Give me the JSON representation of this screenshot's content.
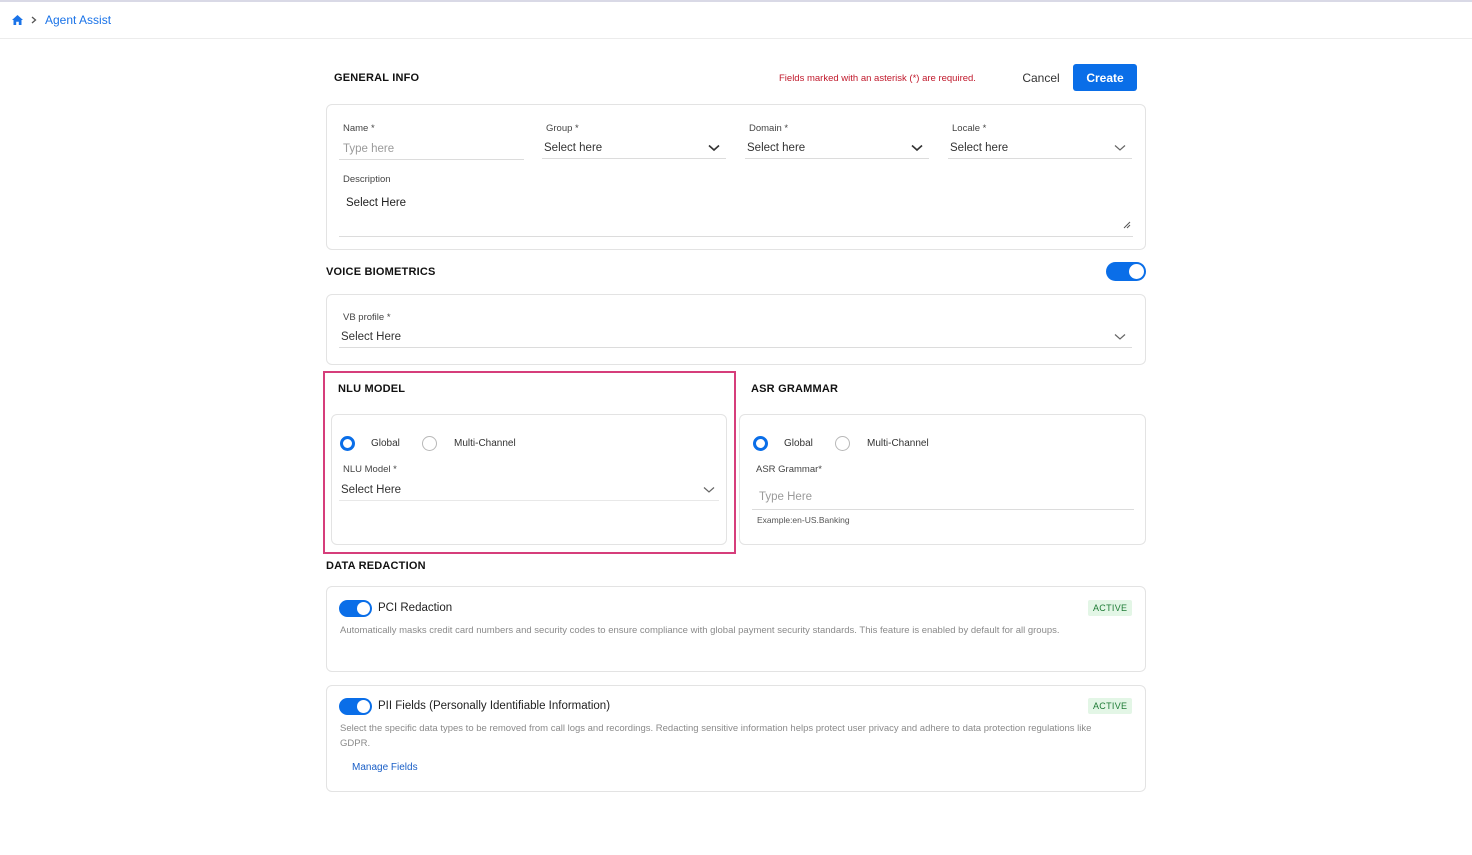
{
  "breadcrumb": {
    "current": "Agent Assist"
  },
  "general_info": {
    "title": "GENERAL INFO",
    "required_note": "Fields marked with an asterisk (*) are required.",
    "cancel_label": "Cancel",
    "create_label": "Create",
    "name": {
      "label": "Name *",
      "placeholder": "Type here"
    },
    "group": {
      "label": "Group *",
      "value": "Select here"
    },
    "domain": {
      "label": "Domain *",
      "value": "Select here"
    },
    "locale": {
      "label": "Locale *",
      "value": "Select here"
    },
    "description": {
      "label": "Description",
      "placeholder": "Select Here"
    }
  },
  "voice_biometrics": {
    "title": "VOICE BIOMETRICS",
    "enabled": true,
    "vb_profile": {
      "label": "VB profile *",
      "value": "Select Here"
    }
  },
  "nlu_model": {
    "title": "NLU MODEL",
    "options": [
      "Global",
      "Multi-Channel"
    ],
    "selected": "Global",
    "field": {
      "label": "NLU Model *",
      "value": "Select Here"
    }
  },
  "asr_grammar": {
    "title": "ASR GRAMMAR",
    "options": [
      "Global",
      "Multi-Channel"
    ],
    "selected": "Global",
    "field": {
      "label": "ASR Grammar*",
      "placeholder": "Type Here",
      "hint": "Example:en-US.Banking"
    }
  },
  "data_redaction": {
    "title": "DATA REDACTION",
    "items": [
      {
        "title": "PCI Redaction",
        "status": "ACTIVE",
        "enabled": true,
        "description": "Automatically masks credit card numbers and security codes to ensure compliance with global payment security standards. This feature is enabled by default for all groups."
      },
      {
        "title": "PII Fields (Personally Identifiable Information)",
        "status": "ACTIVE",
        "enabled": true,
        "description": "Select the specific data types to be removed from call logs and recordings. Redacting sensitive information helps protect user privacy and adhere to data protection regulations like GDPR.",
        "link": "Manage Fields"
      }
    ]
  },
  "colors": {
    "accent": "#0a6ee8",
    "highlight": "#d63e7b",
    "required": "#c0182b",
    "active_bg": "#e3f6e6",
    "active_text": "#1e7b35"
  }
}
